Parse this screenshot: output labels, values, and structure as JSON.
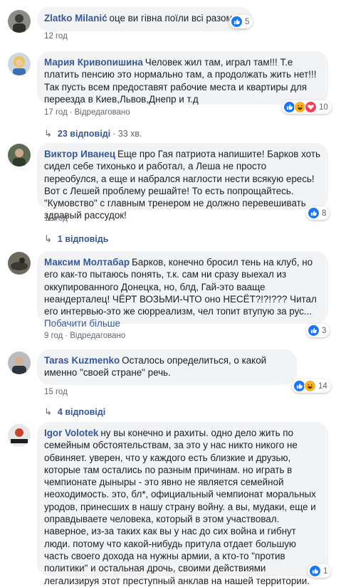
{
  "comments": [
    {
      "author": "Zlatko Milanić",
      "text": "оце ви гівна поїли всі разом",
      "time": "12 год",
      "edited": "",
      "reaction_count": "5"
    },
    {
      "author": "Мария Кривопишина",
      "text": "Человек жил там, играл там!!! Т.е платить пенсию это нормально там, а продолжать жить нет!!! Так пусть всем предоставят рабочие места и квартиры для переезда в Киев,Львов,Днепр и т.д",
      "time": "17 год",
      "edited": "Відредаговано",
      "reaction_count": "10",
      "replies": "23 відповіді",
      "replies_time": "33 хв."
    },
    {
      "author": "Виктор Иванец",
      "text": "Еще про Гая патриота напишите! Барков хоть сидел себе тихонько и работал, а Леша не просто переобулся, а еще и набрался наглости нести всякую ересь! Вот с Лешей проблему решайте! То есть попрощайтесь. \"Кумовство\" с главным тренером не должно перевешивать здравый рассудок!",
      "time": "12 год",
      "edited": "",
      "reaction_count": "8",
      "replies": "1 відповідь"
    },
    {
      "author": "Максим Молтабар",
      "text": "Барков, конечно бросил тень на клуб, но его как-то пытаюсь понять, т.к. сам ни сразу выехал из оккупированного Донецка, но, блд, Гай-это вааще неандерталец! ЧЁРТ ВОЗЬМИ-ЧТО оно НЕСЁТ?!?!??? Читал его интервью-это же сюрреализм, чел топит втупую за рус...",
      "see_more": "Побачити більше",
      "time": "9 год",
      "edited": "Відредаговано",
      "reaction_count": "3"
    },
    {
      "author": "Taras Kuzmenko",
      "text": "Осталось определиться, о какой именно \"своей стране\" речь.",
      "time": "15 год",
      "edited": "",
      "reaction_count": "14",
      "replies": "4 відповіді"
    },
    {
      "author": "Igor Volotek",
      "text": "ну вы конечно и рахиты. одно дело жить по семейным обстоятельствам, за это у нас никто никого не обвиняет. уверен, что у каждого есть близкие и друзью, которые там остались по разным причинам. но играть в чемпионате дыныры - это явно не является семейной неоходимость. это, бл*, официальный чемпионат моральных уродов, принесших в нашу страну войну. а вы, мудаки, еще и оправдываете человека, который в этом участвовал. наверное, из-за таких как вы у нас до сих война и гибнут люди. потому что какой-нибудь притула отдает большую часть своего дохода на нужны армии, а кто-то \"против политики\" и остальная дрочь, своими действиями легализируя этот преступный анклав на нашей территории.",
      "reaction_count": "1"
    }
  ],
  "colors": {
    "like": "#1877f2",
    "love": "#f33e58",
    "haha": "#f7b125",
    "link": "#385898",
    "bubble": "#f2f3f5"
  },
  "icons": {
    "like": "thumbs-up-icon",
    "love": "heart-icon",
    "haha": "laughing-face-icon",
    "reply_arrow": "reply-arrow-icon"
  }
}
